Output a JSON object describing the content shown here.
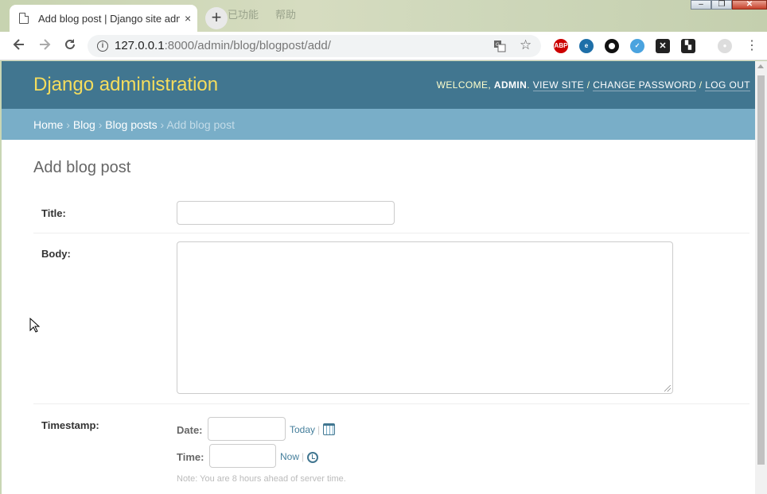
{
  "browser": {
    "tab_title": "Add blog post | Django site admin",
    "tab_close": "×",
    "new_tab": "+",
    "url_host": "127.0.0.1",
    "url_path": ":8000/admin/blog/blogpost/add/",
    "window_controls": {
      "minimize": "–",
      "maximize": "❐",
      "close": "✕"
    },
    "desktop_text": [
      "已功能",
      "帮助"
    ]
  },
  "header": {
    "branding": "Django administration",
    "welcome": "WELCOME, ",
    "user": "ADMIN",
    "view_site": "VIEW SITE",
    "change_password": "CHANGE PASSWORD",
    "log_out": "LOG OUT"
  },
  "breadcrumbs": {
    "home": "Home",
    "blog": "Blog",
    "blog_posts": "Blog posts",
    "current": "Add blog post"
  },
  "content": {
    "title": "Add blog post"
  },
  "form": {
    "title_label": "Title:",
    "title_value": "",
    "body_label": "Body:",
    "body_value": "",
    "timestamp_label": "Timestamp:",
    "date_label": "Date:",
    "date_value": "",
    "today_link": "Today",
    "time_label": "Time:",
    "time_value": "",
    "now_link": "Now",
    "note": "Note: You are 8 hours ahead of server time."
  }
}
